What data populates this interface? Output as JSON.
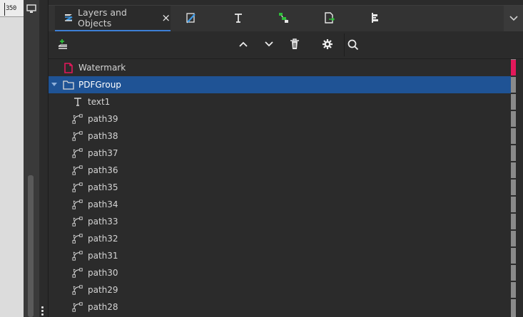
{
  "canvas": {
    "ruler_label": "350",
    "display_icon": "monitor-icon"
  },
  "tabs": {
    "layers": {
      "label": "Layers and Objects",
      "icon": "layers-icon",
      "close": "×"
    },
    "others": [
      {
        "name": "fill-stroke-tab",
        "icon": "pen-brush-icon"
      },
      {
        "name": "text-font-tab",
        "icon": "text-icon"
      },
      {
        "name": "xml-editor-tab",
        "icon": "node-graph-icon"
      },
      {
        "name": "export-tab",
        "icon": "document-export-icon"
      },
      {
        "name": "align-tab",
        "icon": "align-distribute-icon"
      }
    ],
    "more_icon": "chevron-down-icon"
  },
  "toolbar": {
    "add_layer_icon": "add-layer-icon",
    "raise_icon": "chevron-up-icon",
    "lower_icon": "chevron-down-icon",
    "delete_icon": "trash-icon",
    "settings_icon": "gear-icon",
    "search_icon": "search-icon",
    "search_value": ""
  },
  "tree": {
    "items": [
      {
        "label": "Watermark",
        "type": "layer",
        "indent": 0,
        "selected": false
      },
      {
        "label": "PDFGroup",
        "type": "group",
        "indent": 0,
        "selected": true,
        "expanded": true
      },
      {
        "label": "text1",
        "type": "text",
        "indent": 1,
        "selected": false
      },
      {
        "label": "path39",
        "type": "path",
        "indent": 1,
        "selected": false
      },
      {
        "label": "path38",
        "type": "path",
        "indent": 1,
        "selected": false
      },
      {
        "label": "path37",
        "type": "path",
        "indent": 1,
        "selected": false
      },
      {
        "label": "path36",
        "type": "path",
        "indent": 1,
        "selected": false
      },
      {
        "label": "path35",
        "type": "path",
        "indent": 1,
        "selected": false
      },
      {
        "label": "path34",
        "type": "path",
        "indent": 1,
        "selected": false
      },
      {
        "label": "path33",
        "type": "path",
        "indent": 1,
        "selected": false
      },
      {
        "label": "path32",
        "type": "path",
        "indent": 1,
        "selected": false
      },
      {
        "label": "path31",
        "type": "path",
        "indent": 1,
        "selected": false
      },
      {
        "label": "path30",
        "type": "path",
        "indent": 1,
        "selected": false
      },
      {
        "label": "path29",
        "type": "path",
        "indent": 1,
        "selected": false
      },
      {
        "label": "path28",
        "type": "path",
        "indent": 1,
        "selected": false
      }
    ]
  },
  "colors": {
    "accent": "#3d7fd6",
    "selection": "#1f5395",
    "layer_icon": "#e3185b",
    "add_green": "#2fbf3a"
  }
}
